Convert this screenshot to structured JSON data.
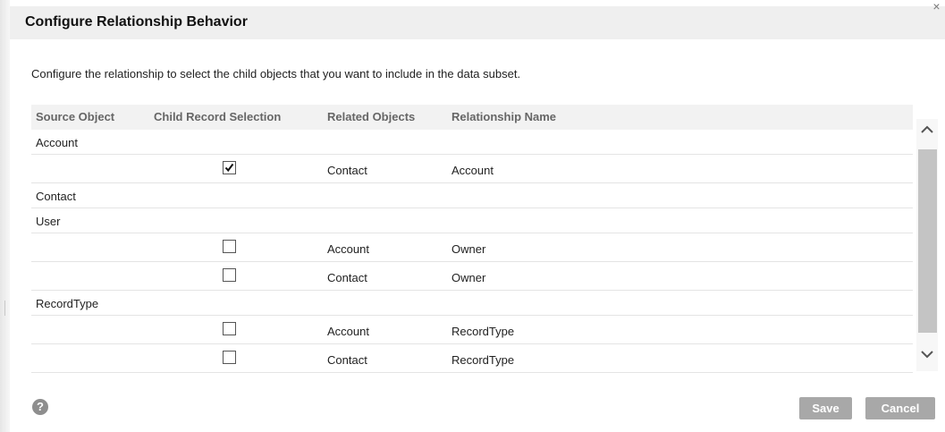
{
  "dialog": {
    "title": "Configure Relationship Behavior",
    "close_label": "×",
    "description": "Configure the relationship to select the child objects that you want to include in the data subset."
  },
  "table": {
    "columns": [
      "Source Object",
      "Child Record Selection",
      "Related Objects",
      "Relationship Name"
    ],
    "rows": [
      {
        "type": "group",
        "source": "Account"
      },
      {
        "type": "child",
        "checked": true,
        "related": "Contact",
        "relationship": "Account"
      },
      {
        "type": "group",
        "source": "Contact"
      },
      {
        "type": "group",
        "source": "User"
      },
      {
        "type": "child",
        "checked": false,
        "related": "Account",
        "relationship": "Owner"
      },
      {
        "type": "child",
        "checked": false,
        "related": "Contact",
        "relationship": "Owner"
      },
      {
        "type": "group",
        "source": "RecordType"
      },
      {
        "type": "child",
        "checked": false,
        "related": "Account",
        "relationship": "RecordType"
      },
      {
        "type": "child",
        "checked": false,
        "related": "Contact",
        "relationship": "RecordType"
      }
    ]
  },
  "icons": {
    "help": "question-circle-icon",
    "help_glyph": "?",
    "scroll_up": "chevron-up-icon",
    "scroll_down": "chevron-down-icon",
    "close": "close-icon",
    "check": "checkmark-icon"
  },
  "footer": {
    "save_label": "Save",
    "cancel_label": "Cancel"
  },
  "colors": {
    "header_bg": "#efefef",
    "button_bg": "#a8a8a8",
    "table_header_bg": "#f2f2f2",
    "scroll_thumb": "#c4c4c4"
  }
}
